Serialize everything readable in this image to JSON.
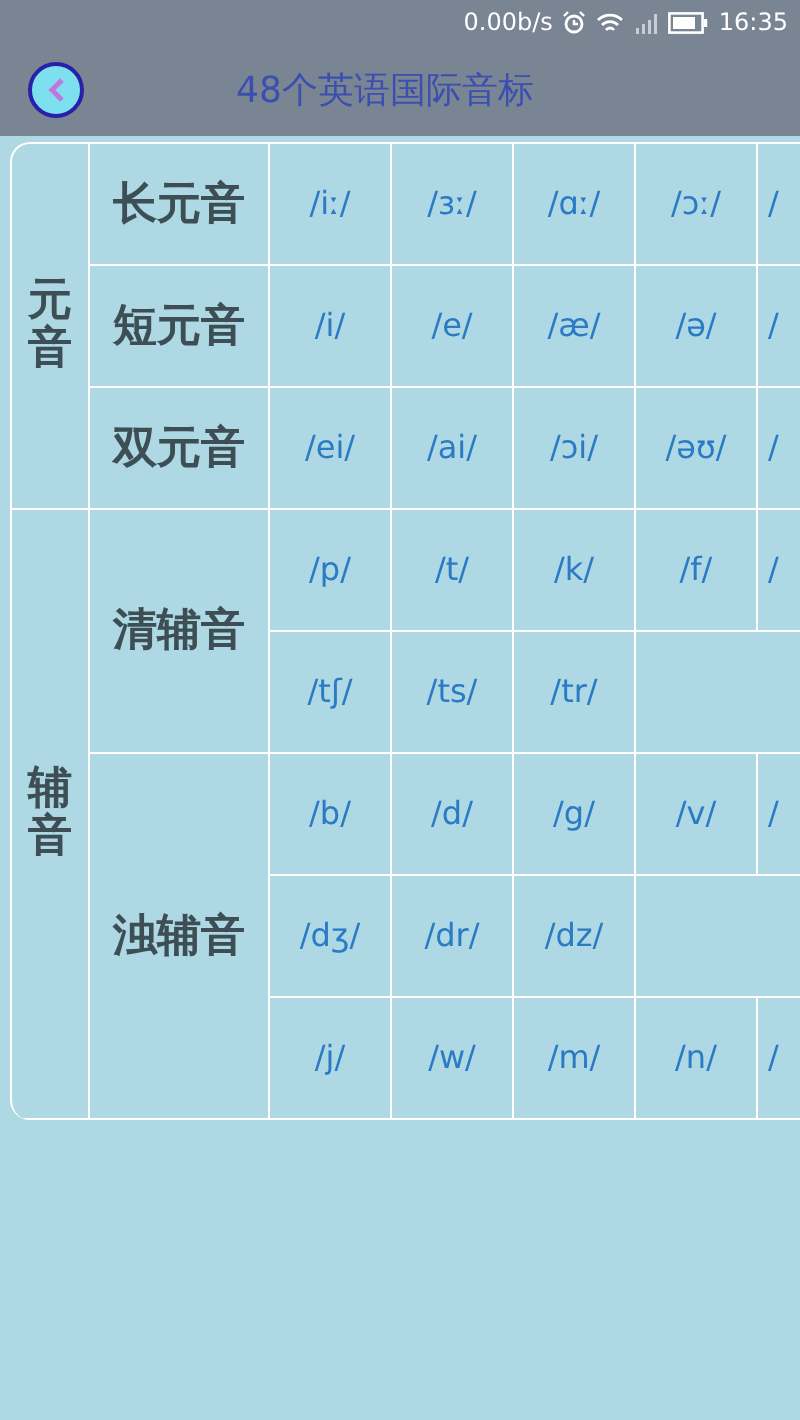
{
  "status_bar": {
    "speed": "0.00b/s",
    "time": "16:35"
  },
  "header": {
    "title": "48个英语国际音标"
  },
  "groups": [
    {
      "label": "元音",
      "subgroups": [
        {
          "label": "长元音",
          "rows": [
            [
              "/iː/",
              "/ɜː/",
              "/ɑː/",
              "/ɔː/",
              "/"
            ]
          ]
        },
        {
          "label": "短元音",
          "rows": [
            [
              "/i/",
              "/e/",
              "/æ/",
              "/ə/",
              "/"
            ]
          ]
        },
        {
          "label": "双元音",
          "rows": [
            [
              "/ei/",
              "/ai/",
              "/ɔi/",
              "/əʊ/",
              "/"
            ]
          ]
        }
      ]
    },
    {
      "label": "辅音",
      "subgroups": [
        {
          "label": "清辅音",
          "rows": [
            [
              "/p/",
              "/t/",
              "/k/",
              "/f/",
              "/"
            ],
            [
              "/tʃ/",
              "/ts/",
              "/tr/"
            ]
          ]
        },
        {
          "label": "浊辅音",
          "rows": [
            [
              "/b/",
              "/d/",
              "/g/",
              "/v/",
              "/"
            ],
            [
              "/dʒ/",
              "/dr/",
              "/dz/"
            ],
            [
              "/j/",
              "/w/",
              "/m/",
              "/n/",
              "/"
            ]
          ]
        }
      ]
    }
  ]
}
